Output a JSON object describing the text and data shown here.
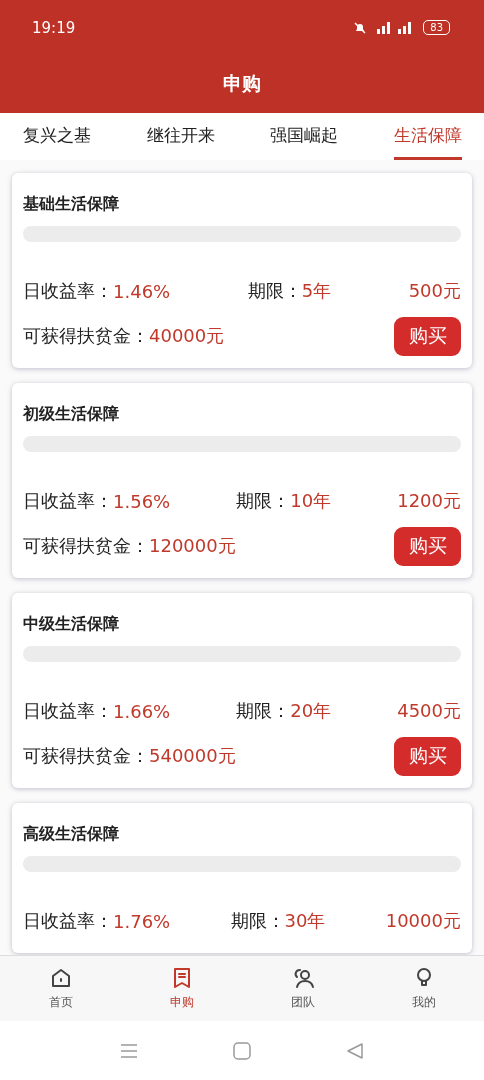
{
  "status_bar": {
    "time": "19:19",
    "battery": "83"
  },
  "header": {
    "title": "申购"
  },
  "tabs": [
    {
      "label": "复兴之基",
      "selected": false
    },
    {
      "label": "继往开来",
      "selected": false
    },
    {
      "label": "强国崛起",
      "selected": false
    },
    {
      "label": "生活保障",
      "selected": true
    }
  ],
  "products": [
    {
      "name": "基础生活保障",
      "level": 0,
      "rate_label": "日收益率：",
      "rate": "1.46%",
      "term_label": "期限：",
      "term": "5年",
      "price": "500元",
      "bonus_label": "可获得扶贫金：",
      "bonus": "40000元",
      "button": "购买"
    },
    {
      "name": "初级生活保障",
      "level": 0,
      "rate_label": "日收益率：",
      "rate": "1.56%",
      "term_label": "期限：",
      "term": "10年",
      "price": "1200元",
      "bonus_label": "可获得扶贫金：",
      "bonus": "120000元",
      "button": "购买"
    },
    {
      "name": "中级生活保障",
      "level": 0,
      "rate_label": "日收益率：",
      "rate": "1.66%",
      "term_label": "期限：",
      "term": "20年",
      "price": "4500元",
      "bonus_label": "可获得扶贫金：",
      "bonus": "540000元",
      "button": "购买"
    },
    {
      "name": "高级生活保障",
      "level": 0,
      "rate_label": "日收益率：",
      "rate": "1.76%",
      "term_label": "期限：",
      "term": "30年",
      "price": "10000元"
    }
  ],
  "bottom_nav": [
    {
      "kind": "home",
      "label": "首页",
      "selected": false
    },
    {
      "kind": "orders",
      "label": "申购",
      "selected": true
    },
    {
      "kind": "team",
      "label": "团队",
      "selected": false
    },
    {
      "kind": "profile",
      "label": "我的",
      "selected": false
    }
  ]
}
